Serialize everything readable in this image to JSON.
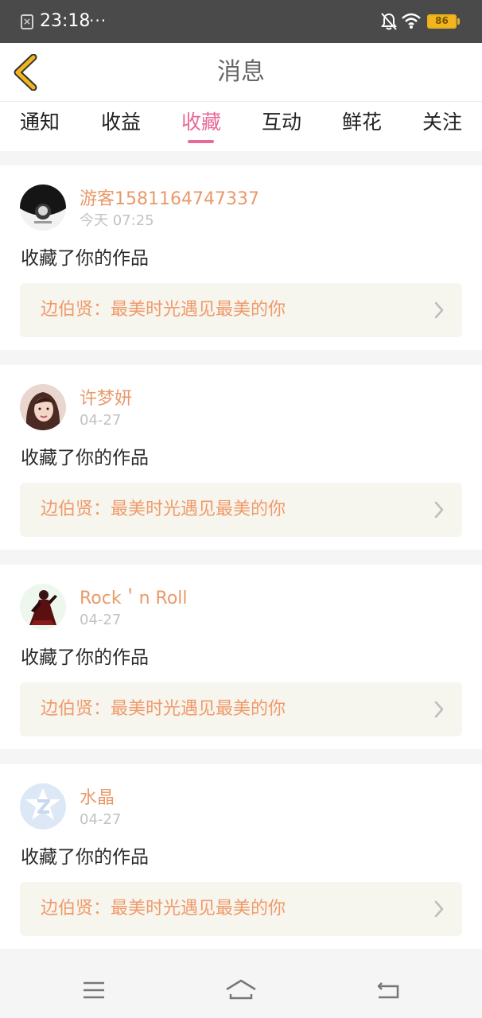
{
  "status_bar": {
    "time": "23:18",
    "dots": "···",
    "battery": "86",
    "icons": [
      "app-close-icon",
      "bell-muted-icon",
      "wifi-icon",
      "battery-icon"
    ]
  },
  "header": {
    "title": "消息",
    "back_icon": "chevron-left-icon",
    "accent_color": "#f2b51c"
  },
  "tabs": [
    {
      "label": "通知",
      "active": false
    },
    {
      "label": "收益",
      "active": false
    },
    {
      "label": "收藏",
      "active": true
    },
    {
      "label": "互动",
      "active": false
    },
    {
      "label": "鲜花",
      "active": false
    },
    {
      "label": "关注",
      "active": false
    }
  ],
  "colors": {
    "tab_active": "#e86a9a",
    "username": "#e89a6a",
    "work_title": "#f09a6a"
  },
  "messages": [
    {
      "username": "游客1581164747337",
      "date": "今天 07:25",
      "action": "收藏了你的作品",
      "work_title": "边伯贤：最美时光遇见最美的你"
    },
    {
      "username": "许梦妍",
      "date": "04-27",
      "action": "收藏了你的作品",
      "work_title": "边伯贤：最美时光遇见最美的你"
    },
    {
      "username": "Rock＇n Roll",
      "date": "04-27",
      "action": "收藏了你的作品",
      "work_title": "边伯贤：最美时光遇见最美的你"
    },
    {
      "username": "水晶",
      "date": "04-27",
      "action": "收藏了你的作品",
      "work_title": "边伯贤：最美时光遇见最美的你"
    }
  ],
  "bottom_nav": {
    "icons": [
      "menu-icon",
      "home-icon",
      "back-icon"
    ]
  }
}
